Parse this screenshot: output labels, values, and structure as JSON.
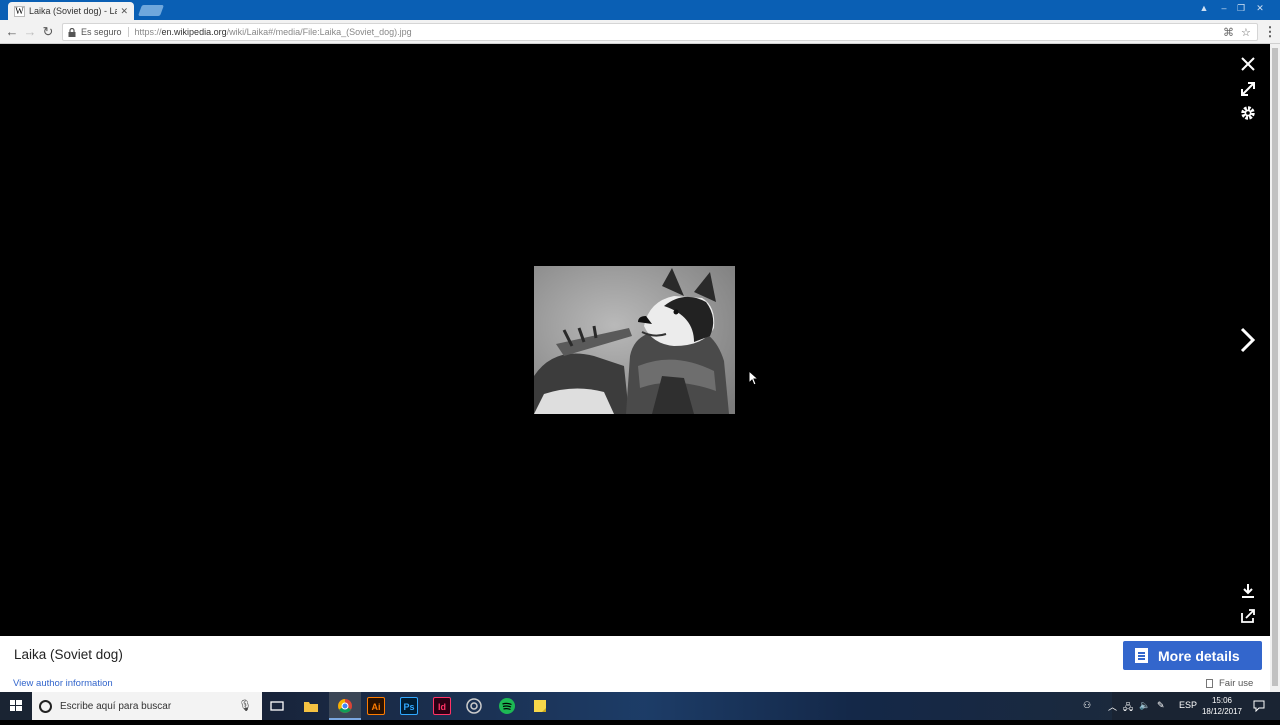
{
  "browser": {
    "tab_title": "Laika (Soviet dog) - Laika",
    "favicon_letter": "W",
    "security_label": "Es seguro",
    "url_scheme": "https://",
    "url_host": "en.wikipedia.org",
    "url_path": "/wiki/Laika#/media/File:Laika_(Soviet_dog).jpg",
    "icons": [
      "back-arrow-icon",
      "forward-arrow-icon",
      "reload-icon",
      "lock-icon",
      "translate-icon",
      "star-icon",
      "menu-dots-icon"
    ]
  },
  "viewer": {
    "controls": [
      "close-icon",
      "fullscreen-icon",
      "settings-gear-icon",
      "next-arrow-icon",
      "download-icon",
      "share-icon"
    ]
  },
  "info": {
    "title": "Laika (Soviet dog)",
    "author_link": "View author information",
    "more_details": "More details",
    "license": "Fair use"
  },
  "taskbar": {
    "search_placeholder": "Escribe aquí para buscar",
    "apps": [
      {
        "name": "file-explorer",
        "label": ""
      },
      {
        "name": "chrome",
        "label": ""
      },
      {
        "name": "illustrator",
        "label": "Ai",
        "color": "#ff7c00"
      },
      {
        "name": "photoshop",
        "label": "Ps",
        "color": "#31a8ff"
      },
      {
        "name": "indesign",
        "label": "Id",
        "color": "#ff3366"
      },
      {
        "name": "camera",
        "label": ""
      },
      {
        "name": "spotify",
        "label": "",
        "color": "#1db954"
      },
      {
        "name": "sticky-notes",
        "label": "",
        "color": "#f7d84a"
      }
    ],
    "language": "ESP",
    "time": "15:06",
    "date": "18/12/2017"
  },
  "colors": {
    "chrome_blue": "#0a5fb4",
    "wiki_button_blue": "#3366cc",
    "taskbar_bg": "#1a2433"
  }
}
